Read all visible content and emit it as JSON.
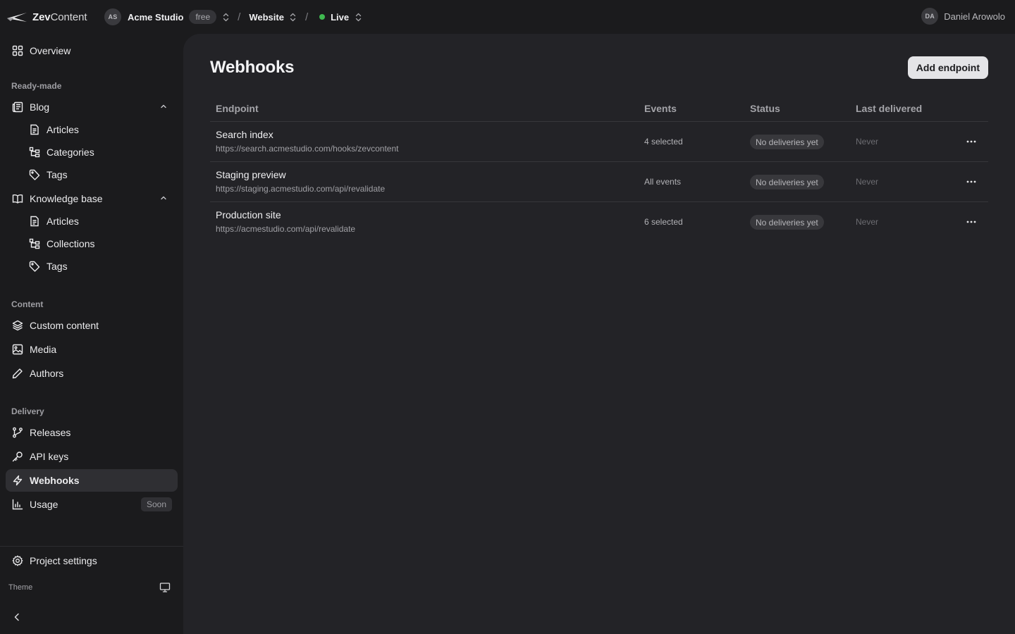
{
  "brand": {
    "bold": "Zev",
    "rest": "Content"
  },
  "breadcrumb": {
    "org_initials": "AS",
    "org_name": "Acme Studio",
    "plan": "free",
    "project": "Website",
    "environment": "Live",
    "environment_color": "#3fb950"
  },
  "user": {
    "initials": "DA",
    "name": "Daniel Arowolo"
  },
  "sidebar": {
    "overview": "Overview",
    "sections": {
      "ready_made": "Ready-made",
      "content": "Content",
      "delivery": "Delivery"
    },
    "blog": {
      "label": "Blog",
      "articles": "Articles",
      "categories": "Categories",
      "tags": "Tags"
    },
    "knowledge_base": {
      "label": "Knowledge base",
      "articles": "Articles",
      "collections": "Collections",
      "tags": "Tags"
    },
    "content": {
      "custom_content": "Custom content",
      "media": "Media",
      "authors": "Authors"
    },
    "delivery": {
      "releases": "Releases",
      "api_keys": "API keys",
      "webhooks": "Webhooks",
      "usage": "Usage",
      "usage_badge": "Soon"
    },
    "project_settings": "Project settings",
    "theme_label": "Theme"
  },
  "page": {
    "title": "Webhooks",
    "add_button": "Add endpoint",
    "columns": {
      "endpoint": "Endpoint",
      "events": "Events",
      "status": "Status",
      "last_delivered": "Last delivered"
    },
    "rows": [
      {
        "name": "Search index",
        "url": "https://search.acmestudio.com/hooks/zevcontent",
        "events": "4 selected",
        "status": "No deliveries yet",
        "last": "Never"
      },
      {
        "name": "Staging preview",
        "url": "https://staging.acmestudio.com/api/revalidate",
        "events": "All events",
        "status": "No deliveries yet",
        "last": "Never"
      },
      {
        "name": "Production site",
        "url": "https://acmestudio.com/api/revalidate",
        "events": "6 selected",
        "status": "No deliveries yet",
        "last": "Never"
      }
    ]
  },
  "colors": {
    "accent_live": "#3fb950",
    "background": "#1b1b1d",
    "panel": "#232327"
  }
}
